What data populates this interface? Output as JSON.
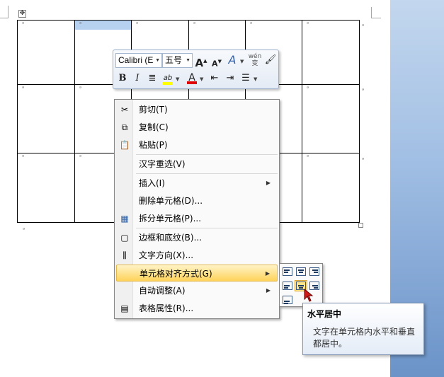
{
  "document": {
    "cell_mark": "ᵃ",
    "table_handle": "✥"
  },
  "mini_toolbar": {
    "font_name": "Calibri (E",
    "font_size": "五号",
    "grow_font": "A",
    "shrink_font": "A",
    "style_button": "A",
    "phonetic_button": "wén 变",
    "bold": "B",
    "italic": "I",
    "highlight_label": "ab",
    "font_color_label": "A"
  },
  "context_menu": {
    "items": [
      {
        "label": "剪切(T)",
        "icon": "scissors-icon"
      },
      {
        "label": "复制(C)",
        "icon": "copy-icon"
      },
      {
        "label": "粘贴(P)",
        "icon": "paste-icon"
      },
      {
        "label": "汉字重选(V)",
        "icon": ""
      },
      {
        "label": "插入(I)",
        "icon": ""
      },
      {
        "label": "删除单元格(D)...",
        "icon": ""
      },
      {
        "label": "拆分单元格(P)...",
        "icon": "split-cells-icon"
      },
      {
        "label": "边框和底纹(B)...",
        "icon": "borders-icon"
      },
      {
        "label": "文字方向(X)...",
        "icon": "text-direction-icon"
      },
      {
        "label": "单元格对齐方式(G)",
        "icon": ""
      },
      {
        "label": "自动调整(A)",
        "icon": ""
      },
      {
        "label": "表格属性(R)...",
        "icon": "table-properties-icon"
      }
    ]
  },
  "tooltip": {
    "title": "水平居中",
    "body": "文字在单元格内水平和垂直都居中。"
  },
  "colors": {
    "highlight_color": "#ffd35b",
    "font_color": "#e00000",
    "text_highlight": "#ffff00"
  }
}
